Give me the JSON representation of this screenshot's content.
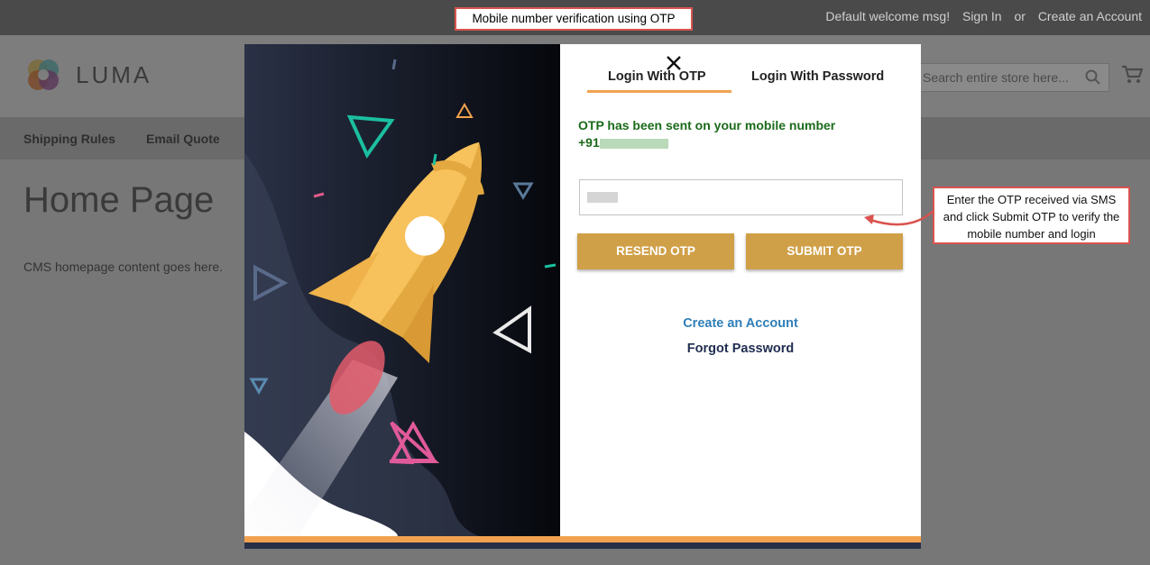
{
  "header": {
    "welcome": "Default welcome msg!",
    "sign_in": "Sign In",
    "or": "or",
    "create_account": "Create an Account",
    "logo_text": "LUMA",
    "search_placeholder": "Search entire store here..."
  },
  "nav": {
    "items": [
      "Shipping Rules",
      "Email Quote"
    ]
  },
  "page": {
    "title": "Home Page",
    "content": "CMS homepage content goes here."
  },
  "callouts": {
    "top": "Mobile number verification using OTP",
    "right": "Enter the OTP received via SMS and click Submit OTP to verify the mobile number and login"
  },
  "modal": {
    "tabs": [
      "Login With OTP",
      "Login With Password"
    ],
    "active_tab": "Login With OTP",
    "message": "OTP has been sent on your mobile number",
    "mobile_prefix": "+91",
    "resend_label": "RESEND OTP",
    "submit_label": "SUBMIT OTP",
    "create_account_link": "Create an Account",
    "forgot_password_link": "Forgot Password",
    "close_icon": "close-icon"
  },
  "colors": {
    "accent": "#f2a24f",
    "button": "#d0a048",
    "success_text": "#1a6a1a",
    "link_blue": "#2f7fb8",
    "callout_border": "#d9534f"
  }
}
